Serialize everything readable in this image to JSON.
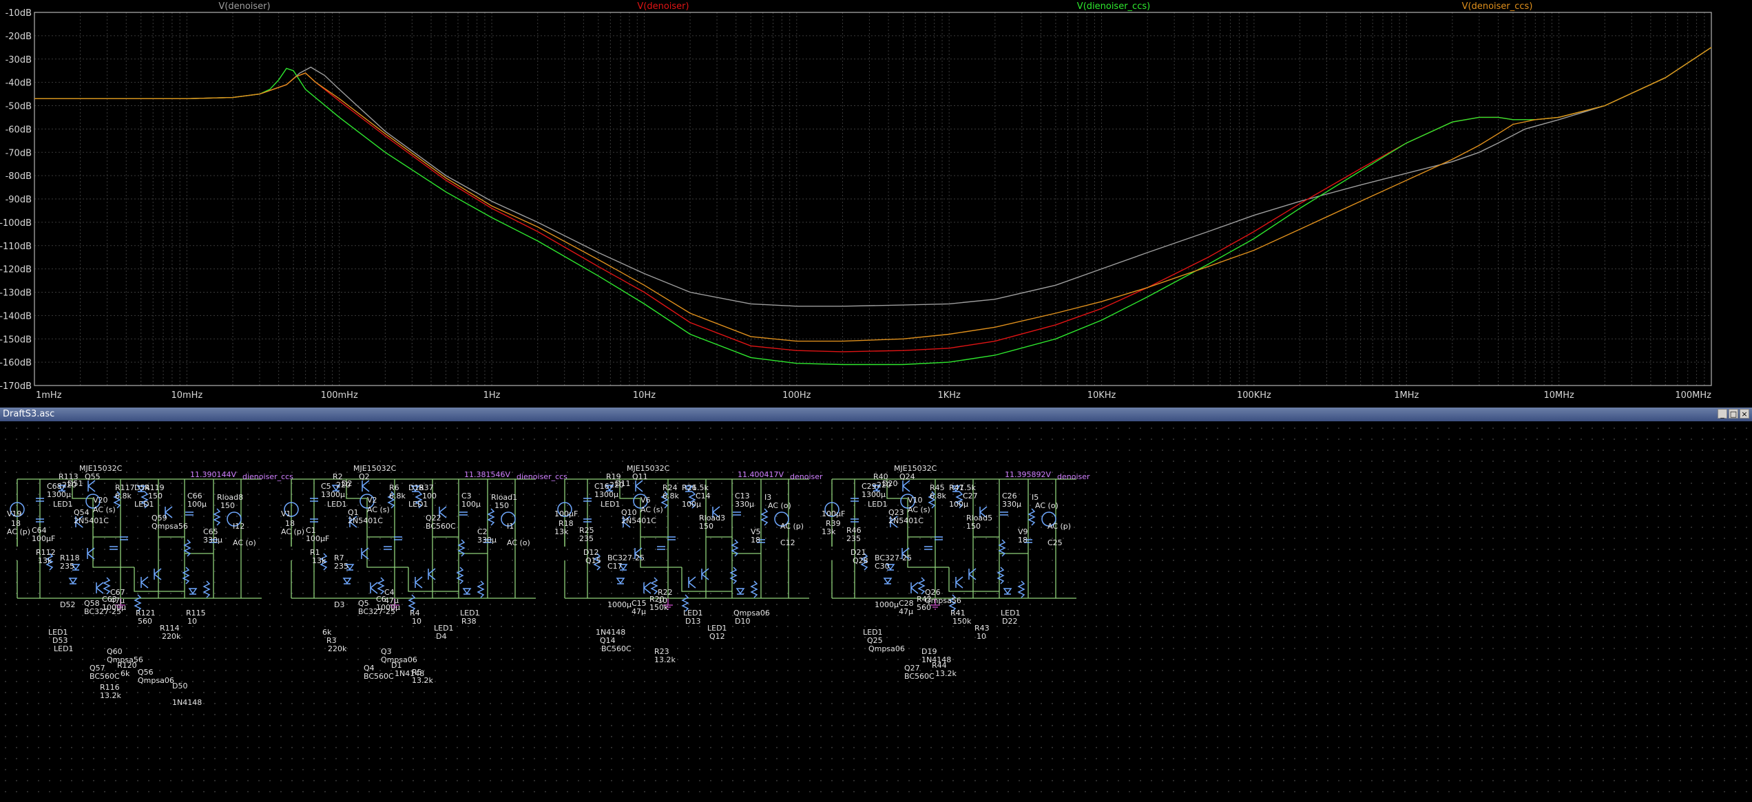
{
  "colors": {
    "background": "#000000",
    "grid": "#3b3b3b",
    "frame": "#b5b5b5",
    "axis_text": "#d7d7d7",
    "wire": "#8fd17a",
    "component": "#6fa8ff",
    "net_label": "#d080ff"
  },
  "chart_data": {
    "type": "line",
    "x_scale": "log",
    "y_unit": "dB",
    "ylim": [
      -170,
      -10
    ],
    "xlim": [
      0.001,
      100000000
    ],
    "grid": true,
    "legend_placement": "top",
    "y_ticks": [
      "-10dB",
      "-20dB",
      "-30dB",
      "-40dB",
      "-50dB",
      "-60dB",
      "-70dB",
      "-80dB",
      "-90dB",
      "-100dB",
      "-110dB",
      "-120dB",
      "-130dB",
      "-140dB",
      "-150dB",
      "-160dB",
      "-170dB"
    ],
    "y_tick_values": [
      -10,
      -20,
      -30,
      -40,
      -50,
      -60,
      -70,
      -80,
      -90,
      -100,
      -110,
      -120,
      -130,
      -140,
      -150,
      -160,
      -170
    ],
    "x_ticks": [
      "1mHz",
      "10mHz",
      "100mHz",
      "1Hz",
      "10Hz",
      "100Hz",
      "1KHz",
      "10KHz",
      "100KHz",
      "1MHz",
      "10MHz",
      "100MHz"
    ],
    "x_tick_values": [
      0.001,
      0.01,
      0.1,
      1,
      10,
      100,
      1000,
      10000,
      100000,
      1000000,
      10000000,
      100000000
    ],
    "series": [
      {
        "name": "V(denoiser)",
        "color": "#9e9e9e",
        "x": [
          0.001,
          0.01,
          0.02,
          0.03,
          0.045,
          0.055,
          0.065,
          0.08,
          0.1,
          0.2,
          0.5,
          1,
          2,
          5,
          10,
          20,
          50,
          100,
          200,
          500,
          1000,
          2000,
          5000,
          10000,
          20000,
          50000,
          100000,
          200000,
          500000,
          1000000,
          2000000,
          3000000,
          4000000,
          6000000,
          10000000,
          20000000,
          50000000,
          100000000
        ],
        "y": [
          -47,
          -47,
          -46.5,
          -45,
          -41,
          -36,
          -33.5,
          -37,
          -43,
          -61,
          -80,
          -91,
          -100,
          -113,
          -122,
          -130,
          -135,
          -136,
          -136,
          -135.5,
          -135,
          -133,
          -127,
          -120,
          -113,
          -104,
          -97,
          -91,
          -84,
          -79,
          -74,
          -70,
          -66,
          -60,
          -56,
          -50,
          -38,
          -25
        ]
      },
      {
        "name": "V(denoiser)",
        "color": "#e01414",
        "x": [
          0.001,
          0.01,
          0.02,
          0.03,
          0.045,
          0.052,
          0.06,
          0.07,
          0.1,
          0.2,
          0.5,
          1,
          2,
          5,
          10,
          20,
          50,
          100,
          200,
          500,
          1000,
          2000,
          5000,
          10000,
          20000,
          50000,
          100000,
          200000,
          500000,
          1000000,
          2000000,
          3000000,
          4000000,
          5000000,
          7000000,
          10000000,
          20000000,
          50000000,
          100000000
        ],
        "y": [
          -47,
          -47,
          -46.5,
          -45,
          -41,
          -37.5,
          -36,
          -40,
          -48,
          -63,
          -82,
          -94,
          -104,
          -119,
          -130,
          -143,
          -153,
          -155,
          -155.5,
          -155,
          -154,
          -151,
          -144,
          -137,
          -128,
          -115,
          -104,
          -92,
          -77,
          -66,
          -57,
          -55,
          -55,
          -56,
          -56,
          -55,
          -50,
          -38,
          -25
        ]
      },
      {
        "name": "V(dienoiser_ccs)",
        "color": "#2ee82e",
        "x": [
          0.001,
          0.01,
          0.02,
          0.03,
          0.035,
          0.04,
          0.045,
          0.05,
          0.06,
          0.1,
          0.2,
          0.5,
          1,
          2,
          5,
          10,
          20,
          50,
          100,
          200,
          500,
          1000,
          2000,
          5000,
          10000,
          20000,
          50000,
          100000,
          200000,
          500000,
          1000000,
          2000000,
          3000000,
          4000000,
          5000000,
          7000000,
          10000000,
          20000000,
          50000000,
          100000000
        ],
        "y": [
          -47,
          -47,
          -46.5,
          -45,
          -43,
          -39,
          -34,
          -35,
          -43,
          -55,
          -70,
          -87,
          -98,
          -108,
          -123,
          -135,
          -148,
          -158,
          -160.5,
          -161,
          -161,
          -160,
          -157,
          -150,
          -142,
          -132,
          -118,
          -107,
          -94,
          -78,
          -66,
          -57,
          -55,
          -55,
          -56,
          -56,
          -55,
          -50,
          -38,
          -25
        ]
      },
      {
        "name": "V(denoiser_ccs)",
        "color": "#e0901c",
        "x": [
          0.001,
          0.01,
          0.02,
          0.03,
          0.045,
          0.052,
          0.06,
          0.07,
          0.1,
          0.2,
          0.5,
          1,
          2,
          5,
          10,
          20,
          50,
          100,
          200,
          500,
          1000,
          2000,
          5000,
          10000,
          20000,
          50000,
          100000,
          200000,
          500000,
          1000000,
          2000000,
          3000000,
          4000000,
          5000000,
          7000000,
          10000000,
          20000000,
          50000000,
          100000000
        ],
        "y": [
          -47,
          -47,
          -46.5,
          -45,
          -41,
          -37.5,
          -36,
          -40,
          -47,
          -62,
          -81,
          -93,
          -102,
          -116,
          -127,
          -139,
          -149,
          -151,
          -151,
          -150,
          -148,
          -145,
          -139,
          -134,
          -128,
          -119,
          -112,
          -103,
          -91,
          -82,
          -73,
          -67,
          -62,
          -58,
          -56,
          -55,
          -50,
          -38,
          -25
        ]
      }
    ]
  },
  "schematic": {
    "window_title": "DraftS3.asc",
    "window_buttons": [
      "_",
      "□",
      "×"
    ],
    "circuits": [
      {
        "net_output": "dienoiser_ccs",
        "dc_voltage": "11.390144V",
        "labels": [
          {
            "text": "MJE15032C"
          },
          {
            "text": "Q55"
          },
          {
            "text": "V20"
          },
          {
            "text": "AC (s)"
          },
          {
            "text": "C68"
          },
          {
            "text": "1300µ"
          },
          {
            "text": "D51"
          },
          {
            "text": "R113"
          },
          {
            "text": "220"
          },
          {
            "text": "LED1"
          },
          {
            "text": "Q54"
          },
          {
            "text": "2N5401C"
          },
          {
            "text": "R117"
          },
          {
            "text": "6.8k"
          },
          {
            "text": "D54"
          },
          {
            "text": "R119"
          },
          {
            "text": "150"
          },
          {
            "text": "LED1"
          },
          {
            "text": "Q59"
          },
          {
            "text": "Qmpsa56"
          },
          {
            "text": "C66"
          },
          {
            "text": "100µ"
          },
          {
            "text": "Rload8"
          },
          {
            "text": "150"
          },
          {
            "text": "C65"
          },
          {
            "text": "330µ"
          },
          {
            "text": "I12"
          },
          {
            "text": "AC (o)"
          },
          {
            "text": "V19"
          },
          {
            "text": "18"
          },
          {
            "text": "AC (p)"
          },
          {
            "text": "C64"
          },
          {
            "text": "100µF"
          },
          {
            "text": "R112"
          },
          {
            "text": "13k"
          },
          {
            "text": "R118"
          },
          {
            "text": "235"
          },
          {
            "text": "D52"
          },
          {
            "text": "Q58"
          },
          {
            "text": "BC327-25"
          },
          {
            "text": "C63"
          },
          {
            "text": "1000µ"
          },
          {
            "text": "C67"
          },
          {
            "text": "47µ"
          },
          {
            "text": "R121"
          },
          {
            "text": "560"
          },
          {
            "text": "R114"
          },
          {
            "text": "220k"
          },
          {
            "text": "R115"
          },
          {
            "text": "10"
          },
          {
            "text": "LED1"
          },
          {
            "text": "D53"
          },
          {
            "text": "LED1"
          },
          {
            "text": "Q60"
          },
          {
            "text": "Qmpsa56"
          },
          {
            "text": "Q57"
          },
          {
            "text": "BC560C"
          },
          {
            "text": "R120"
          },
          {
            "text": "6k"
          },
          {
            "text": "Q56"
          },
          {
            "text": "Qmpsa06"
          },
          {
            "text": "D50"
          },
          {
            "text": "1N4148"
          },
          {
            "text": "R116"
          },
          {
            "text": "13.2k"
          }
        ]
      },
      {
        "net_output": "dienoiser_ccs",
        "dc_voltage": "11.381546V",
        "labels": [
          {
            "text": "MJE15032C"
          },
          {
            "text": "Q2"
          },
          {
            "text": "V2"
          },
          {
            "text": "AC (s)"
          },
          {
            "text": "C5"
          },
          {
            "text": "1300µ"
          },
          {
            "text": "D2"
          },
          {
            "text": "R2"
          },
          {
            "text": "220"
          },
          {
            "text": "LED1"
          },
          {
            "text": "Q1"
          },
          {
            "text": "2N5401C"
          },
          {
            "text": "R6"
          },
          {
            "text": "6.8k"
          },
          {
            "text": "D18"
          },
          {
            "text": "R37"
          },
          {
            "text": "100"
          },
          {
            "text": "LED1"
          },
          {
            "text": "Q22"
          },
          {
            "text": "BC560C"
          },
          {
            "text": "C3"
          },
          {
            "text": "100µ"
          },
          {
            "text": "Rload1"
          },
          {
            "text": "150"
          },
          {
            "text": "C2"
          },
          {
            "text": "330µ"
          },
          {
            "text": "I1"
          },
          {
            "text": "AC (o)"
          },
          {
            "text": "V1"
          },
          {
            "text": "18"
          },
          {
            "text": "AC (p)"
          },
          {
            "text": "C1"
          },
          {
            "text": "100µF"
          },
          {
            "text": "R1"
          },
          {
            "text": "13k"
          },
          {
            "text": "R7"
          },
          {
            "text": "235"
          },
          {
            "text": "D3"
          },
          {
            "text": "Q5"
          },
          {
            "text": "BC327-25"
          },
          {
            "text": "C6"
          },
          {
            "text": "1000µ"
          },
          {
            "text": "C4"
          },
          {
            "text": "47µ"
          },
          {
            "text": "R4"
          },
          {
            "text": "10"
          },
          {
            "text": "LED1"
          },
          {
            "text": "D4"
          },
          {
            "text": "LED1"
          },
          {
            "text": "R38"
          },
          {
            "text": "6k"
          },
          {
            "text": "R3"
          },
          {
            "text": "220k"
          },
          {
            "text": "Q3"
          },
          {
            "text": "Qmpsa06"
          },
          {
            "text": "Q4"
          },
          {
            "text": "BC560C"
          },
          {
            "text": "D1"
          },
          {
            "text": "1N4148"
          },
          {
            "text": "R5"
          },
          {
            "text": "13.2k"
          }
        ]
      },
      {
        "net_output": "denoiser",
        "dc_voltage": "11.400417V",
        "labels": [
          {
            "text": "MJE15032C"
          },
          {
            "text": "Q11"
          },
          {
            "text": "V6"
          },
          {
            "text": "AC (s)"
          },
          {
            "text": "C16"
          },
          {
            "text": "1300µ"
          },
          {
            "text": "D11"
          },
          {
            "text": "R19"
          },
          {
            "text": "220"
          },
          {
            "text": "LED1"
          },
          {
            "text": "Q10"
          },
          {
            "text": "2N5401C"
          },
          {
            "text": "R24"
          },
          {
            "text": "6.8k"
          },
          {
            "text": "R26"
          },
          {
            "text": "1.5k"
          },
          {
            "text": "C14"
          },
          {
            "text": "100µ"
          },
          {
            "text": "Rload3"
          },
          {
            "text": "150"
          },
          {
            "text": "C13"
          },
          {
            "text": "330µ"
          },
          {
            "text": "I3"
          },
          {
            "text": "AC (o)"
          },
          {
            "text": "V5"
          },
          {
            "text": "18"
          },
          {
            "text": "AC (p)"
          },
          {
            "text": "C12"
          },
          {
            "text": "100µF"
          },
          {
            "text": "R18"
          },
          {
            "text": "13k"
          },
          {
            "text": "R25"
          },
          {
            "text": "235"
          },
          {
            "text": "D12"
          },
          {
            "text": "Q15"
          },
          {
            "text": "BC327-25"
          },
          {
            "text": "C17"
          },
          {
            "text": "1000µ"
          },
          {
            "text": "C15"
          },
          {
            "text": "47µ"
          },
          {
            "text": "R20"
          },
          {
            "text": "150k"
          },
          {
            "text": "R22"
          },
          {
            "text": "10"
          },
          {
            "text": "LED1"
          },
          {
            "text": "D13"
          },
          {
            "text": "LED1"
          },
          {
            "text": "Q12"
          },
          {
            "text": "Qmpsa06"
          },
          {
            "text": "D10"
          },
          {
            "text": "1N4148"
          },
          {
            "text": "Q14"
          },
          {
            "text": "BC560C"
          },
          {
            "text": "R23"
          },
          {
            "text": "13.2k"
          }
        ]
      },
      {
        "net_output": "denoiser",
        "dc_voltage": "11.395892V",
        "labels": [
          {
            "text": "MJE15032C"
          },
          {
            "text": "Q24"
          },
          {
            "text": "V10"
          },
          {
            "text": "AC (s)"
          },
          {
            "text": "C29"
          },
          {
            "text": "1300µ"
          },
          {
            "text": "D20"
          },
          {
            "text": "R40"
          },
          {
            "text": "220"
          },
          {
            "text": "LED1"
          },
          {
            "text": "Q23"
          },
          {
            "text": "2N5401C"
          },
          {
            "text": "R45"
          },
          {
            "text": "6.8k"
          },
          {
            "text": "R47"
          },
          {
            "text": "1.5k"
          },
          {
            "text": "C27"
          },
          {
            "text": "100µ"
          },
          {
            "text": "Rload5"
          },
          {
            "text": "150"
          },
          {
            "text": "C26"
          },
          {
            "text": "330µ"
          },
          {
            "text": "I5"
          },
          {
            "text": "AC (o)"
          },
          {
            "text": "V9"
          },
          {
            "text": "18"
          },
          {
            "text": "AC (p)"
          },
          {
            "text": "C25"
          },
          {
            "text": "100µF"
          },
          {
            "text": "R39"
          },
          {
            "text": "13k"
          },
          {
            "text": "R46"
          },
          {
            "text": "235"
          },
          {
            "text": "D21"
          },
          {
            "text": "Q28"
          },
          {
            "text": "BC327-25"
          },
          {
            "text": "C30"
          },
          {
            "text": "1000µ"
          },
          {
            "text": "C28"
          },
          {
            "text": "47µ"
          },
          {
            "text": "R42"
          },
          {
            "text": "560"
          },
          {
            "text": "Q26"
          },
          {
            "text": "Qmpsa56"
          },
          {
            "text": "R41"
          },
          {
            "text": "150k"
          },
          {
            "text": "R43"
          },
          {
            "text": "10"
          },
          {
            "text": "LED1"
          },
          {
            "text": "D22"
          },
          {
            "text": "LED1"
          },
          {
            "text": "Q25"
          },
          {
            "text": "Qmpsa06"
          },
          {
            "text": "D19"
          },
          {
            "text": "1N4148"
          },
          {
            "text": "Q27"
          },
          {
            "text": "BC560C"
          },
          {
            "text": "R44"
          },
          {
            "text": "13.2k"
          }
        ]
      }
    ]
  }
}
